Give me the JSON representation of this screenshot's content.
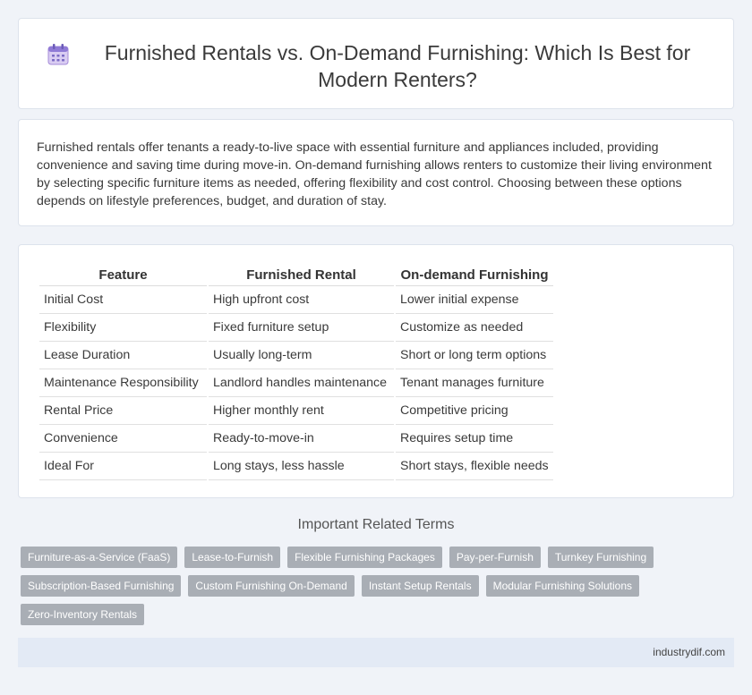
{
  "header": {
    "title": "Furnished Rentals vs. On-Demand Furnishing: Which Is Best for Modern Renters?",
    "icon": "calendar-icon"
  },
  "intro": {
    "text": "Furnished rentals offer tenants a ready-to-live space with essential furniture and appliances included, providing convenience and saving time during move-in. On-demand furnishing allows renters to customize their living environment by selecting specific furniture items as needed, offering flexibility and cost control. Choosing between these options depends on lifestyle preferences, budget, and duration of stay."
  },
  "table": {
    "headers": [
      "Feature",
      "Furnished Rental",
      "On-demand Furnishing"
    ],
    "rows": [
      [
        "Initial Cost",
        "High upfront cost",
        "Lower initial expense"
      ],
      [
        "Flexibility",
        "Fixed furniture setup",
        "Customize as needed"
      ],
      [
        "Lease Duration",
        "Usually long-term",
        "Short or long term options"
      ],
      [
        "Maintenance Responsibility",
        "Landlord handles maintenance",
        "Tenant manages furniture"
      ],
      [
        "Rental Price",
        "Higher monthly rent",
        "Competitive pricing"
      ],
      [
        "Convenience",
        "Ready-to-move-in",
        "Requires setup time"
      ],
      [
        "Ideal For",
        "Long stays, less hassle",
        "Short stays, flexible needs"
      ]
    ]
  },
  "related": {
    "title": "Important Related Terms",
    "tags": [
      "Furniture-as-a-Service (FaaS)",
      "Lease-to-Furnish",
      "Flexible Furnishing Packages",
      "Pay-per-Furnish",
      "Turnkey Furnishing",
      "Subscription-Based Furnishing",
      "Custom Furnishing On-Demand",
      "Instant Setup Rentals",
      "Modular Furnishing Solutions",
      "Zero-Inventory Rentals"
    ]
  },
  "footer": {
    "site": "industrydif.com"
  }
}
